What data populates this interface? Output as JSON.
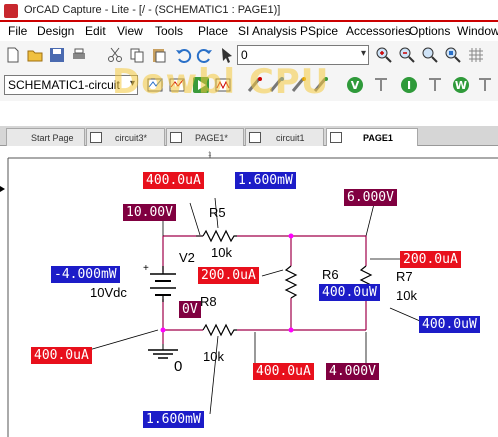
{
  "window": {
    "title": "OrCAD Capture - Lite - [/ - (SCHEMATIC1 : PAGE1)]"
  },
  "menu": {
    "items": [
      "File",
      "Design",
      "Edit",
      "View",
      "Tools",
      "Place",
      "SI Analysis",
      "PSpice",
      "Accessories",
      "Options",
      "Window"
    ]
  },
  "toolbar": {
    "zoom_combo": "0",
    "schematic_combo": "SCHEMATIC1-circuit"
  },
  "watermark": "Dowbl CPU",
  "tabs": [
    {
      "label": "Start Page"
    },
    {
      "label": "circuit3*"
    },
    {
      "label": "PAGE1*"
    },
    {
      "label": "circuit1"
    },
    {
      "label": "PAGE1"
    }
  ],
  "schematic": {
    "components": {
      "V2": {
        "ref": "V2",
        "value": "10Vdc"
      },
      "R5": {
        "ref": "R5",
        "value": "10k"
      },
      "R6": {
        "ref": "R6"
      },
      "R7": {
        "ref": "R7",
        "value": "10k"
      },
      "R8": {
        "ref": "R8",
        "value": "10k"
      },
      "ground": {
        "label": "0"
      }
    },
    "labels": {
      "i_top_left": "400.0uA",
      "p_r5": "1.600mW",
      "v_top_left": "10.00V",
      "v_top_right": "6.000V",
      "p_v2": "-4.000mW",
      "i_r6": "200.0uA",
      "i_r7": "200.0uA",
      "v_bottom_left": "0V",
      "p_r6": "400.0uW",
      "p_r7": "400.0uW",
      "i_bottom_left": "400.0uA",
      "i_bottom_mid": "400.0uA",
      "v_bottom_right": "4.000V",
      "p_r8": "1.600mW"
    }
  },
  "colors": {
    "current": "#e8101c",
    "power": "#1c1cc8",
    "voltage": "#800040",
    "wire": "#a0004a"
  }
}
